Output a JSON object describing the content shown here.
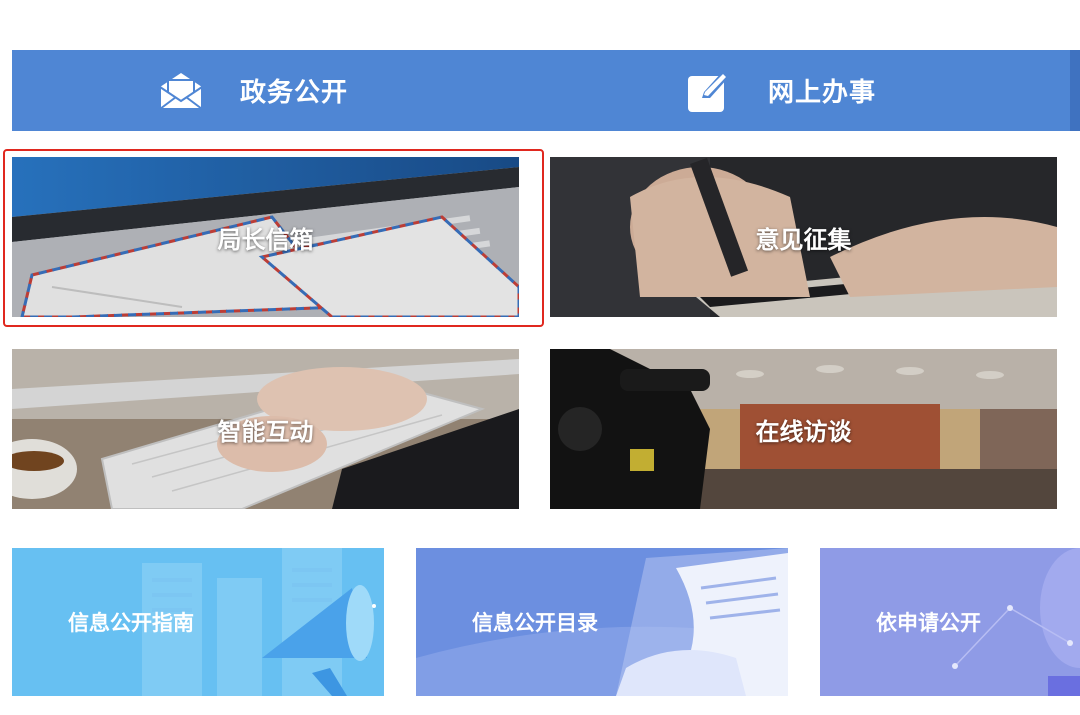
{
  "nav": {
    "gov_affairs": {
      "label": "政务公开",
      "icon": "envelope-icon"
    },
    "online_services": {
      "label": "网上办事",
      "icon": "edit-icon"
    }
  },
  "tiles": [
    {
      "label": "局长信箱",
      "image": "laptop-envelopes"
    },
    {
      "label": "意见征集",
      "image": "hand-writing"
    },
    {
      "label": "智能互动",
      "image": "hands-on-keyboard"
    },
    {
      "label": "在线访谈",
      "image": "video-camera-conference-room"
    }
  ],
  "cards": [
    {
      "label": "信息公开指南",
      "image": "megaphone-buildings"
    },
    {
      "label": "信息公开目录",
      "image": "document-pages"
    },
    {
      "label": "依申请公开",
      "image": "network-dots"
    }
  ],
  "colors": {
    "nav_bar": "#4f86d4",
    "selection_border": "#e0281f",
    "card_guide": "#67c0f2",
    "card_catalog": "#6c8fe0",
    "card_request": "#8f9be6"
  }
}
